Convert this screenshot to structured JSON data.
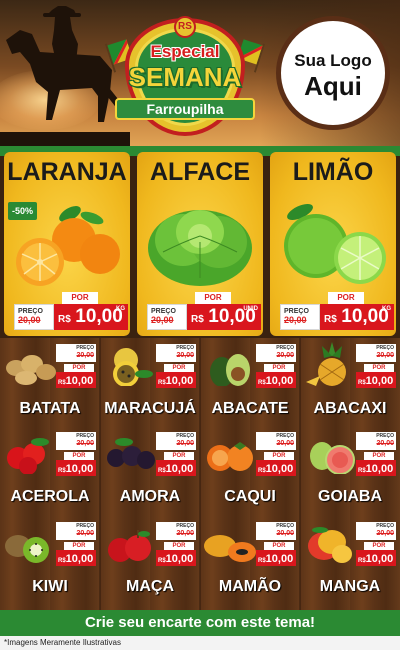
{
  "header": {
    "badge": {
      "rs": "RS",
      "line1": "Especial",
      "line2": "SEMANA",
      "line3": "Farroupilha"
    },
    "logo": {
      "line1": "Sua Logo",
      "line2": "Aqui"
    }
  },
  "featured": [
    {
      "name": "LARANJA",
      "badge": "-50%",
      "preco_label": "PREÇO",
      "old": "20,00",
      "por_label": "POR",
      "currency": "R$",
      "value": "10,00",
      "unit": "KG"
    },
    {
      "name": "ALFACE",
      "badge": "",
      "preco_label": "PREÇO",
      "old": "20,00",
      "por_label": "POR",
      "currency": "R$",
      "value": "10,00",
      "unit": "UNID"
    },
    {
      "name": "LIMÃO",
      "badge": "",
      "preco_label": "PREÇO",
      "old": "20,00",
      "por_label": "POR",
      "currency": "R$",
      "value": "10,00",
      "unit": "KG"
    }
  ],
  "products": [
    {
      "name": "BATATA",
      "preco_label": "PREÇO",
      "old": "20,00",
      "por_label": "POR",
      "currency": "R$",
      "value": "10,00",
      "icon": "potato-icon"
    },
    {
      "name": "MARACUJÁ",
      "preco_label": "PREÇO",
      "old": "20,00",
      "por_label": "POR",
      "currency": "R$",
      "value": "10,00",
      "icon": "passion-fruit-icon"
    },
    {
      "name": "ABACATE",
      "preco_label": "PREÇO",
      "old": "20,00",
      "por_label": "POR",
      "currency": "R$",
      "value": "10,00",
      "icon": "avocado-icon"
    },
    {
      "name": "ABACAXI",
      "preco_label": "PREÇO",
      "old": "20,00",
      "por_label": "POR",
      "currency": "R$",
      "value": "10,00",
      "icon": "pineapple-icon"
    },
    {
      "name": "ACEROLA",
      "preco_label": "PREÇO",
      "old": "20,00",
      "por_label": "POR",
      "currency": "R$",
      "value": "10,00",
      "icon": "acerola-icon"
    },
    {
      "name": "AMORA",
      "preco_label": "PREÇO",
      "old": "20,00",
      "por_label": "POR",
      "currency": "R$",
      "value": "10,00",
      "icon": "blackberry-icon"
    },
    {
      "name": "CAQUI",
      "preco_label": "PREÇO",
      "old": "20,00",
      "por_label": "POR",
      "currency": "R$",
      "value": "10,00",
      "icon": "persimmon-icon"
    },
    {
      "name": "GOIABA",
      "preco_label": "PREÇO",
      "old": "20,00",
      "por_label": "POR",
      "currency": "R$",
      "value": "10,00",
      "icon": "guava-icon"
    },
    {
      "name": "KIWI",
      "preco_label": "PREÇO",
      "old": "20,00",
      "por_label": "POR",
      "currency": "R$",
      "value": "10,00",
      "icon": "kiwi-icon"
    },
    {
      "name": "MAÇA",
      "preco_label": "PREÇO",
      "old": "20,00",
      "por_label": "POR",
      "currency": "R$",
      "value": "10,00",
      "icon": "apple-icon"
    },
    {
      "name": "MAMÃO",
      "preco_label": "PREÇO",
      "old": "20,00",
      "por_label": "POR",
      "currency": "R$",
      "value": "10,00",
      "icon": "papaya-icon"
    },
    {
      "name": "MANGA",
      "preco_label": "PREÇO",
      "old": "20,00",
      "por_label": "POR",
      "currency": "R$",
      "value": "10,00",
      "icon": "mango-icon"
    }
  ],
  "footer": {
    "cta": "Crie seu encarte com este tema!",
    "disclaimer": "*Imagens Meramente Ilustrativas"
  },
  "colors": {
    "accent_green": "#2b8a33",
    "price_red": "#d9161d",
    "card_yellow": "#f0b81e",
    "wood": "#5b3317"
  }
}
